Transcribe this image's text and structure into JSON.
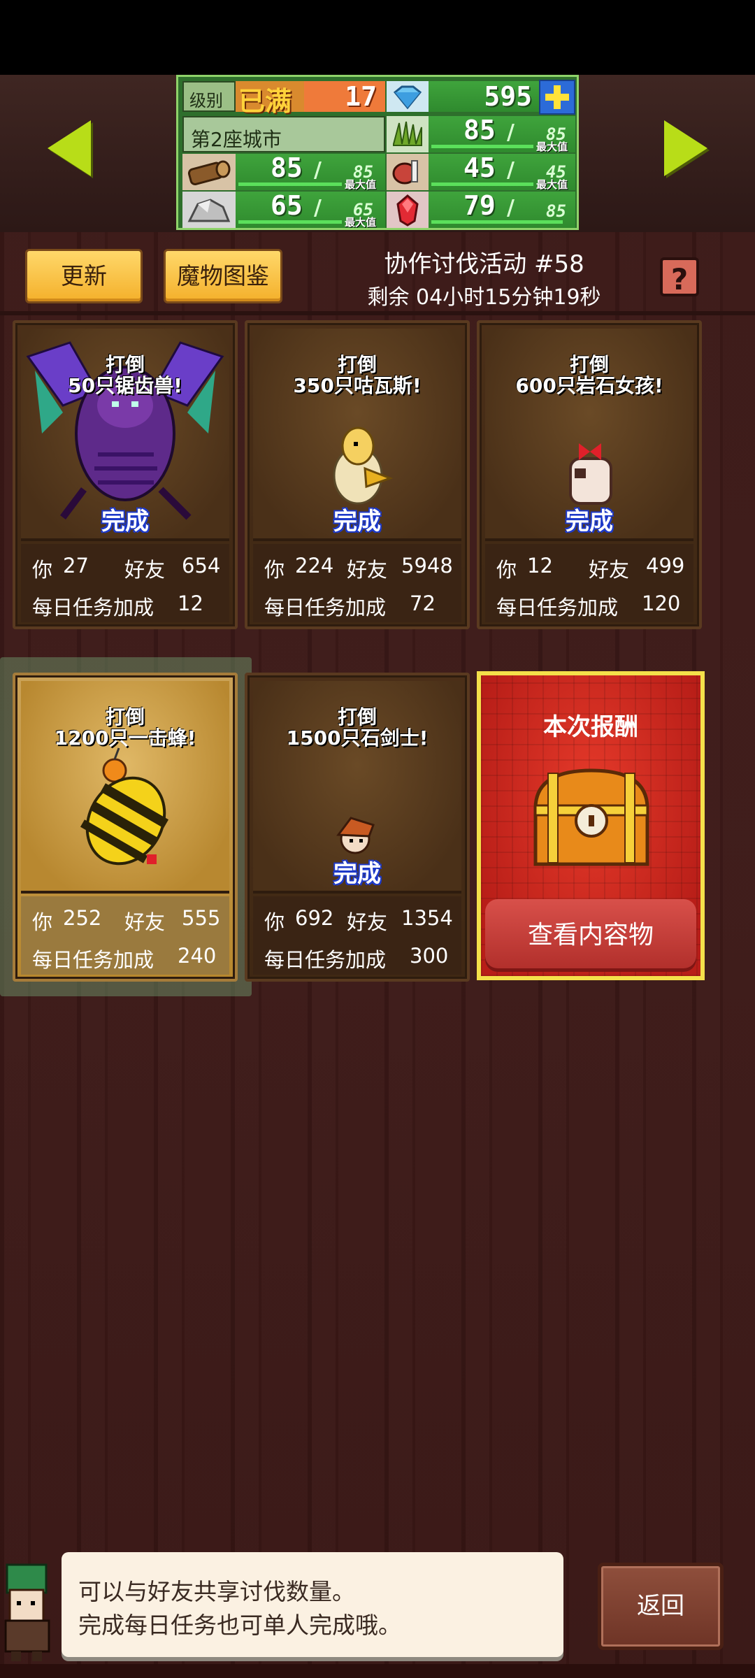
{
  "stats": {
    "level_label": "级别",
    "level_status": "已满",
    "level_value": "17",
    "gems": "595",
    "city_name": "第2座城市",
    "max_label": "最大值",
    "resources": [
      {
        "icon": "wood-log-icon",
        "value": "85",
        "max": "85",
        "fill": 1.0
      },
      {
        "icon": "stone-icon",
        "value": "65",
        "max": "65",
        "fill": 1.0
      },
      {
        "icon": "grass-icon",
        "value": "85",
        "max": "85",
        "fill": 1.0
      },
      {
        "icon": "meat-icon",
        "value": "45",
        "max": "45",
        "fill": 1.0
      },
      {
        "icon": "ruby-icon",
        "value": "79",
        "max": "85",
        "fill": 0.93
      }
    ]
  },
  "header": {
    "refresh_label": "更新",
    "bestiary_label": "魔物图鉴",
    "event_title": "协作讨伐活动 #58",
    "time_remaining": "剩余 04小时15分钟19秒",
    "help_label": "?"
  },
  "quests": [
    {
      "line1": "打倒",
      "line2": "50只锯齿兽!",
      "status": "完成",
      "you_label": "你",
      "you": "27",
      "friends_label": "好友",
      "friends": "654",
      "bonus_label": "每日任务加成",
      "bonus": "12",
      "monster": "bat-dragon-icon"
    },
    {
      "line1": "打倒",
      "line2": "350只咕瓦斯!",
      "status": "完成",
      "you_label": "你",
      "you": "224",
      "friends_label": "好友",
      "friends": "5948",
      "bonus_label": "每日任务加成",
      "bonus": "72",
      "monster": "bird-icon"
    },
    {
      "line1": "打倒",
      "line2": "600只岩石女孩!",
      "status": "完成",
      "you_label": "你",
      "you": "12",
      "friends_label": "好友",
      "friends": "499",
      "bonus_label": "每日任务加成",
      "bonus": "120",
      "monster": "rock-girl-icon"
    },
    {
      "line1": "打倒",
      "line2": "1200只一击蜂!",
      "status": "",
      "you_label": "你",
      "you": "252",
      "friends_label": "好友",
      "friends": "555",
      "bonus_label": "每日任务加成",
      "bonus": "240",
      "monster": "bee-icon"
    },
    {
      "line1": "打倒",
      "line2": "1500只石剑士!",
      "status": "完成",
      "you_label": "你",
      "you": "692",
      "friends_label": "好友",
      "friends": "1354",
      "bonus_label": "每日任务加成",
      "bonus": "300",
      "monster": "swordsman-icon"
    }
  ],
  "reward": {
    "title": "本次报酬",
    "button_label": "查看内容物"
  },
  "dialog": {
    "line1": "可以与好友共享讨伐数量。",
    "line2": "完成每日任务也可单人完成哦。"
  },
  "back_label": "返回",
  "colors": {
    "accent_green": "#b8dd18",
    "panel_green": "#2f8a2e",
    "button_yellow": "#f4b02b",
    "reward_red": "#b81e18",
    "done_blue": "#1d39c8"
  }
}
